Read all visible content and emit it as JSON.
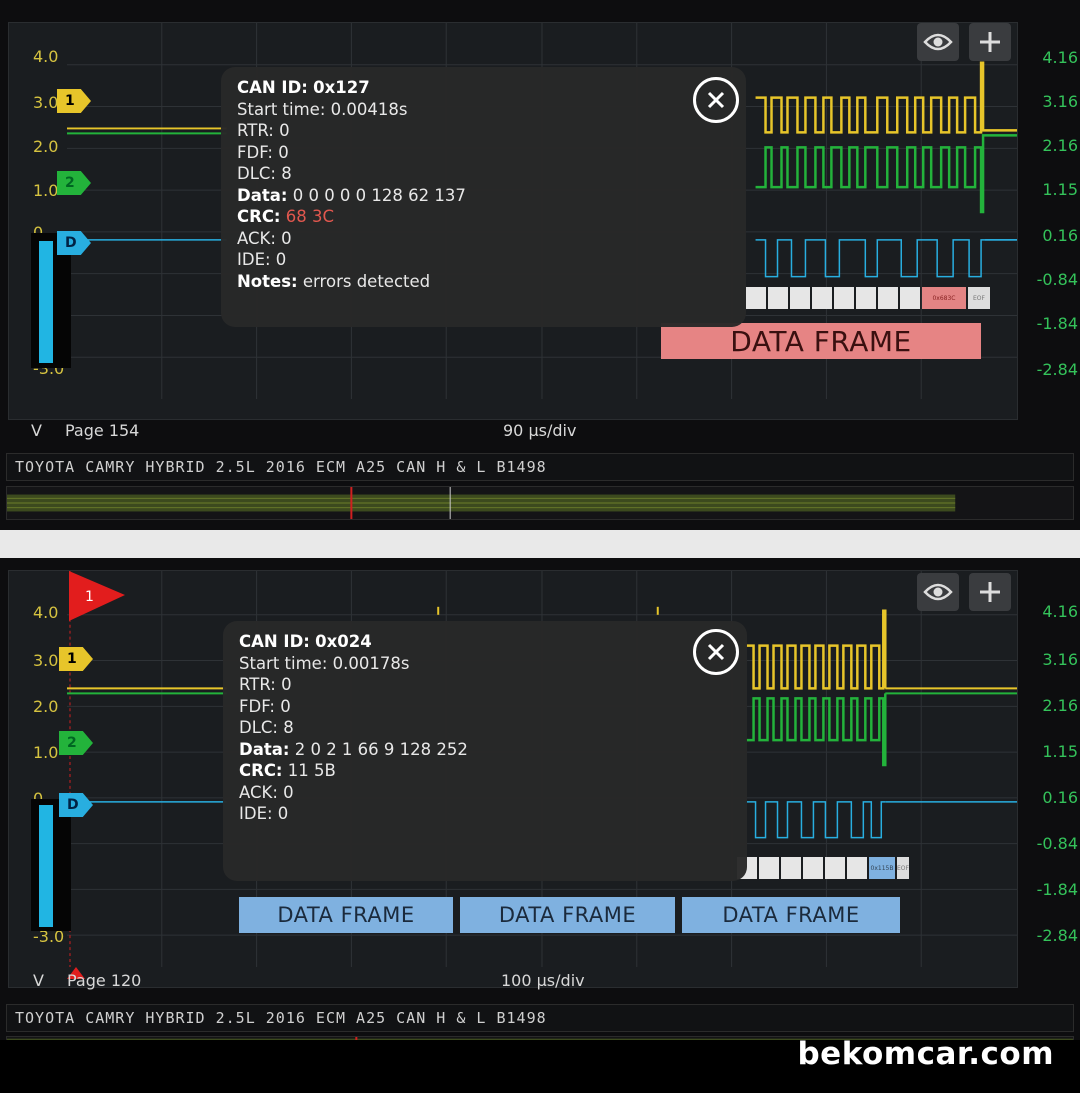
{
  "panels": [
    {
      "left_axis": [
        "4.0",
        "3.0",
        "2.0",
        "1.0",
        "0",
        "-3.0"
      ],
      "right_axis": [
        "4.16",
        "3.16",
        "2.16",
        "1.15",
        "0.16",
        "-0.84",
        "-1.84",
        "-2.84"
      ],
      "channels": [
        "1",
        "2",
        "D"
      ],
      "unit": "V",
      "page": "Page 154",
      "timebase": "90 µs/div",
      "vehicle_title": "TOYOTA CAMRY HYBRID 2.5L 2016 ECM A25 CAN H & L B1498",
      "popup": {
        "can_id_label": "CAN ID:",
        "can_id": "0x127",
        "start_time": "Start time: 0.00418s",
        "rtr": "RTR: 0",
        "fdf": "FDF: 0",
        "dlc": "DLC: 8",
        "data_label": "Data:",
        "data": "0 0 0 0 0 128 62 137",
        "crc_label": "CRC:",
        "crc": "68 3C",
        "ack": "ACK: 0",
        "ide": "IDE: 0",
        "notes_label": "Notes:",
        "notes": "errors detected"
      },
      "frames": [
        "DATA FRAME"
      ],
      "crc_chip": "0x683C",
      "eof_chip": "EOF"
    },
    {
      "left_axis": [
        "4.0",
        "3.0",
        "2.0",
        "1.0",
        "0",
        "-3.0"
      ],
      "right_axis": [
        "4.16",
        "3.16",
        "2.16",
        "1.15",
        "0.16",
        "-0.84",
        "-1.84",
        "-2.84"
      ],
      "channels": [
        "1",
        "1",
        "2",
        "D"
      ],
      "unit": "V",
      "page": "Page 120",
      "timebase": "100 µs/div",
      "vehicle_title": "TOYOTA CAMRY HYBRID 2.5L 2016 ECM A25 CAN H & L B1498",
      "popup": {
        "can_id_label": "CAN ID:",
        "can_id": "0x024",
        "start_time": "Start time: 0.00178s",
        "rtr": "RTR: 0",
        "fdf": "FDF: 0",
        "dlc": "DLC: 8",
        "data_label": "Data:",
        "data": "2 0 2 1 66 9 128 252",
        "crc_label": "CRC:",
        "crc": "11 5B",
        "ack": "ACK: 0",
        "ide": "IDE: 0"
      },
      "frames": [
        "DATA FRAME",
        "DATA FRAME",
        "DATA FRAME"
      ],
      "crc_chip": "0x115B",
      "eof_chip": "EOF"
    }
  ],
  "icons": {
    "eye": "eye-icon",
    "plus": "plus-icon",
    "close": "close-icon"
  },
  "colors": {
    "ch1": "#e7c52a",
    "ch2": "#23b33b",
    "chD": "#28aee0",
    "error": "#e0574e"
  },
  "watermark": "bekomcar.com"
}
